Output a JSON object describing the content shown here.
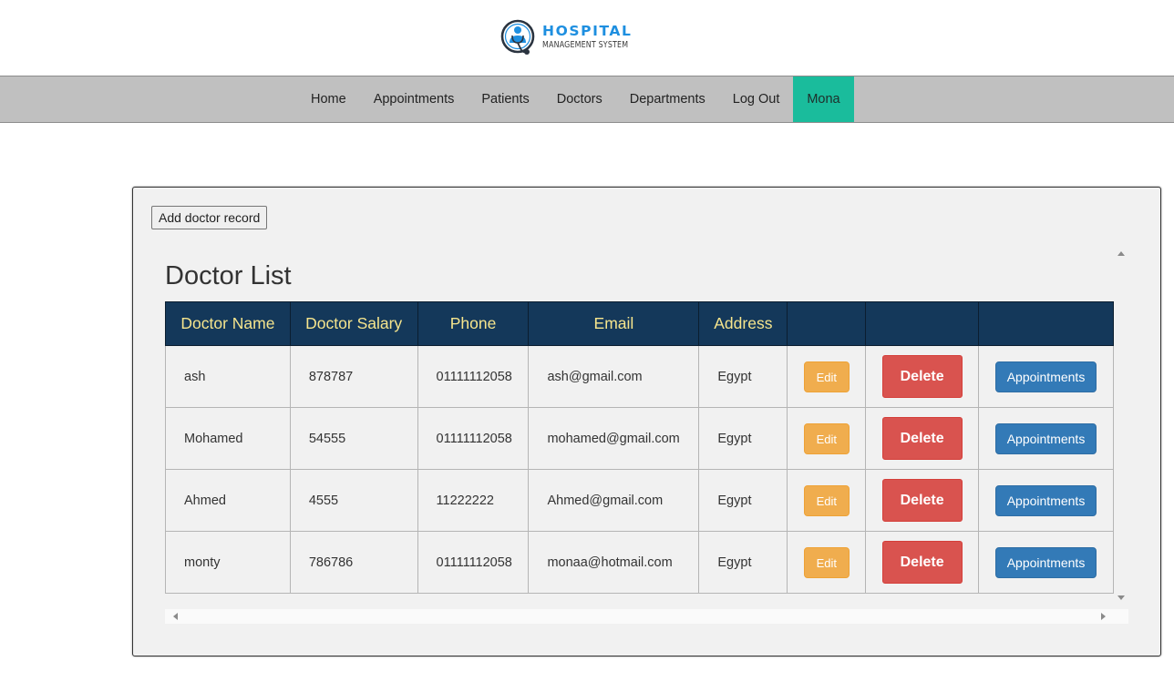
{
  "brand": {
    "title": "HOSPITAL",
    "subtitle": "MANAGEMENT SYSTEM",
    "icon": "stethoscope-doctor-icon",
    "colors": {
      "title": "#1e8fe0"
    }
  },
  "nav": {
    "items": [
      {
        "label": "Home"
      },
      {
        "label": "Appointments"
      },
      {
        "label": "Patients"
      },
      {
        "label": "Doctors"
      },
      {
        "label": "Departments"
      },
      {
        "label": "Log Out"
      },
      {
        "label": "Mona",
        "active": true
      }
    ],
    "colors": {
      "bar": "#c0c0c0",
      "active": "#1abc9c"
    }
  },
  "panel": {
    "add_button_label": "Add doctor record",
    "title": "Doctor List",
    "columns": [
      "Doctor Name",
      "Doctor Salary",
      "Phone",
      "Email",
      "Address",
      "",
      "",
      ""
    ],
    "rows": [
      {
        "name": "ash",
        "salary": "878787",
        "phone": "01111112058",
        "email": "ash@gmail.com",
        "address": "Egypt"
      },
      {
        "name": "Mohamed",
        "salary": "54555",
        "phone": "01111112058",
        "email": "mohamed@gmail.com",
        "address": "Egypt"
      },
      {
        "name": "Ahmed",
        "salary": "4555",
        "phone": "11222222",
        "email": "Ahmed@gmail.com",
        "address": "Egypt"
      },
      {
        "name": "monty",
        "salary": "786786",
        "phone": "01111112058",
        "email": "monaa@hotmail.com",
        "address": "Egypt"
      }
    ],
    "row_actions": {
      "edit": "Edit",
      "delete": "Delete",
      "appointments": "Appointments"
    },
    "colors": {
      "header_bg": "#14385a",
      "header_text": "#f6e58d",
      "edit": "#f0ad4e",
      "delete": "#d9534f",
      "appointments": "#337ab7"
    }
  }
}
